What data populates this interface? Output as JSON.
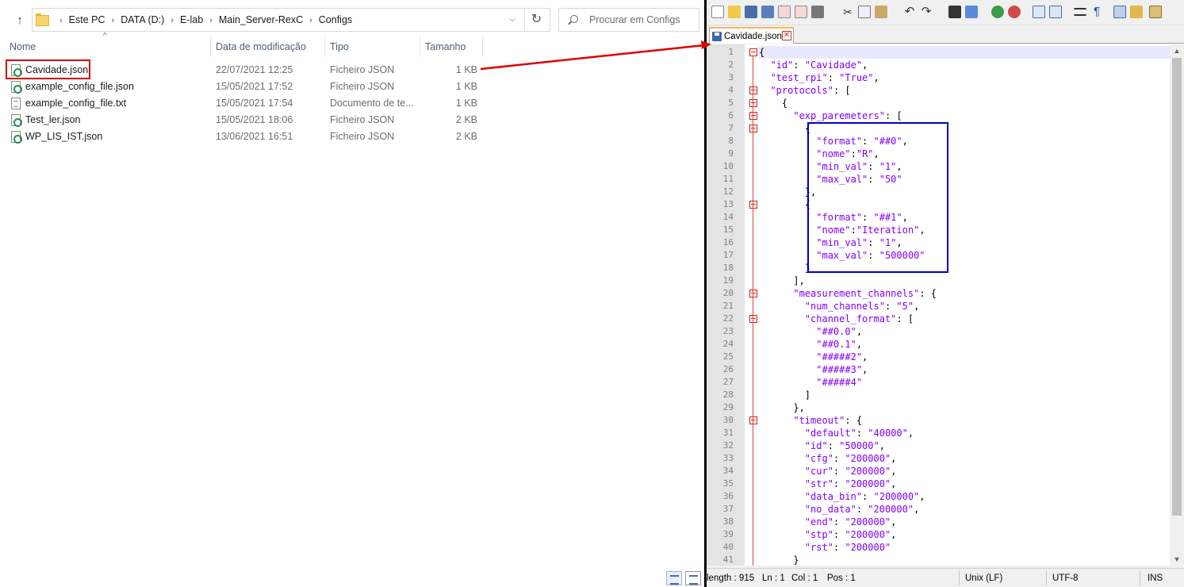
{
  "explorer": {
    "breadcrumb": [
      "Este PC",
      "DATA (D:)",
      "E-lab",
      "Main_Server-RexC",
      "Configs"
    ],
    "search_placeholder": "Procurar em Configs",
    "columns": {
      "name": "Nome",
      "date": "Data de modificação",
      "type": "Tipo",
      "size": "Tamanho"
    },
    "files": [
      {
        "name": "Cavidade.json",
        "date": "22/07/2021 12:25",
        "type": "Ficheiro JSON",
        "size": "1 KB",
        "icon": "json"
      },
      {
        "name": "example_config_file.json",
        "date": "15/05/2021 17:52",
        "type": "Ficheiro JSON",
        "size": "1 KB",
        "icon": "json"
      },
      {
        "name": "example_config_file.txt",
        "date": "15/05/2021 17:54",
        "type": "Documento de te...",
        "size": "1 KB",
        "icon": "txt"
      },
      {
        "name": "Test_ler.json",
        "date": "15/05/2021 18:06",
        "type": "Ficheiro JSON",
        "size": "2 KB",
        "icon": "json"
      },
      {
        "name": "WP_LIS_IST.json",
        "date": "13/06/2021 16:51",
        "type": "Ficheiro JSON",
        "size": "2 KB",
        "icon": "json"
      }
    ],
    "highlight_color": "#d10000"
  },
  "editor": {
    "tab_label": "Cavidade.json",
    "highlight_color": "#0000c8",
    "lines": [
      "{",
      "  \"id\": \"Cavidade\",",
      "  \"test_rpi\": \"True\",",
      "  \"protocols\": [",
      "    {",
      "      \"exp_paremeters\": [",
      "        {",
      "          \"format\": \"##0\",",
      "          \"nome\":\"R\",",
      "          \"min_val\": \"1\",",
      "          \"max_val\": \"50\"",
      "        },",
      "        {",
      "          \"format\": \"##1\",",
      "          \"nome\":\"Iteration\",",
      "          \"min_val\": \"1\",",
      "          \"max_val\": \"500000\"",
      "        }",
      "      ],",
      "      \"measurement_channels\": {",
      "        \"num_channels\": \"5\",",
      "        \"channel_format\": [",
      "          \"##0.0\",",
      "          \"##0.1\",",
      "          \"#####2\",",
      "          \"#####3\",",
      "          \"#####4\"",
      "        ]",
      "      },",
      "      \"timeout\": {",
      "        \"default\": \"40000\",",
      "        \"id\": \"50000\",",
      "        \"cfg\": \"200000\",",
      "        \"cur\": \"200000\",",
      "        \"str\": \"200000\",",
      "        \"data_bin\": \"200000\",",
      "        \"no_data\": \"200000\",",
      "        \"end\": \"200000\",",
      "        \"stp\": \"200000\",",
      "        \"rst\": \"200000\"",
      "      }"
    ],
    "fold_open_lines": [
      1,
      4,
      5,
      6,
      7,
      13,
      20,
      22,
      30
    ],
    "status": {
      "length": "length : 915",
      "ln": "Ln : 1",
      "col": "Col : 1",
      "pos": "Pos : 1",
      "eol": "Unix (LF)",
      "encoding": "UTF-8",
      "mode": "INS"
    }
  }
}
